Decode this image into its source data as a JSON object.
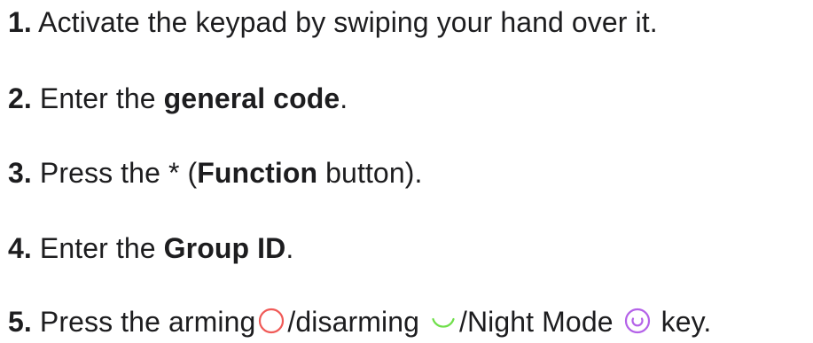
{
  "steps": [
    {
      "number": "1.",
      "text": "Activate the keypad by swiping your hand over it."
    },
    {
      "number": "2.",
      "text_before": "Enter the",
      "bold": "general code",
      "text_after": "."
    },
    {
      "number": "3.",
      "text_before": "Press the * (",
      "bold": "Function",
      "text_after": "button)."
    },
    {
      "number": "4.",
      "text_before": "Enter the",
      "bold": "Group ID",
      "text_after": "."
    },
    {
      "number": "5.",
      "text_before": "Press the arming",
      "text_mid1": "/disarming",
      "text_mid2": "/Night Mode",
      "text_after": "key."
    }
  ],
  "icons": {
    "arm": {
      "name": "arm-circle-icon",
      "color": "#f05a57"
    },
    "disarm": {
      "name": "disarm-arc-icon",
      "color": "#6fdf4a"
    },
    "night": {
      "name": "night-mode-icon",
      "color": "#b462e8"
    }
  }
}
